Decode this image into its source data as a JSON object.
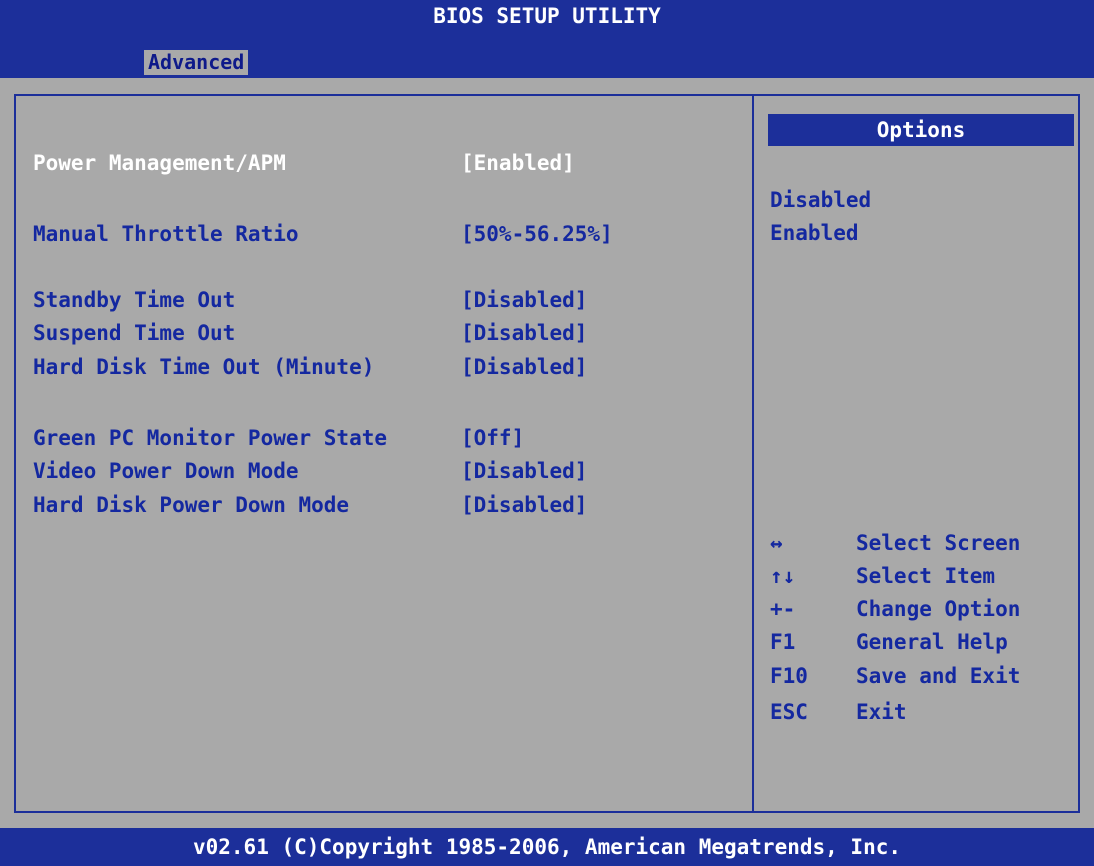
{
  "title": "BIOS SETUP UTILITY",
  "tabs": [
    {
      "label": "Advanced",
      "active": true
    }
  ],
  "settings": [
    {
      "label": "Power Management/APM",
      "value": "[Enabled]",
      "selected": true
    },
    {
      "label": "Manual Throttle Ratio",
      "value": "[50%-56.25%]"
    },
    {
      "label": "Standby Time Out",
      "value": "[Disabled]"
    },
    {
      "label": "Suspend Time Out",
      "value": "[Disabled]"
    },
    {
      "label": "Hard Disk Time Out (Minute)",
      "value": "[Disabled]"
    },
    {
      "label": "Green PC Monitor Power State",
      "value": "[Off]"
    },
    {
      "label": "Video Power Down Mode",
      "value": "[Disabled]"
    },
    {
      "label": "Hard Disk Power Down Mode",
      "value": "[Disabled]"
    }
  ],
  "help": {
    "heading": "Options",
    "options": [
      "Disabled",
      "Enabled"
    ],
    "keys": [
      {
        "key": "↔",
        "desc": "Select Screen"
      },
      {
        "key": "↑↓",
        "desc": "Select Item"
      },
      {
        "key": "+-",
        "desc": "Change Option"
      },
      {
        "key": "F1",
        "desc": "General Help"
      },
      {
        "key": "F10",
        "desc": "Save and Exit"
      },
      {
        "key": "ESC",
        "desc": "Exit"
      }
    ]
  },
  "footer": "v02.61 (C)Copyright 1985-2006, American Megatrends, Inc.",
  "colors": {
    "bar": "#1c2f9a",
    "background": "#a9a9a9",
    "text": "#1428a0",
    "highlight_text": "#ffffff"
  }
}
